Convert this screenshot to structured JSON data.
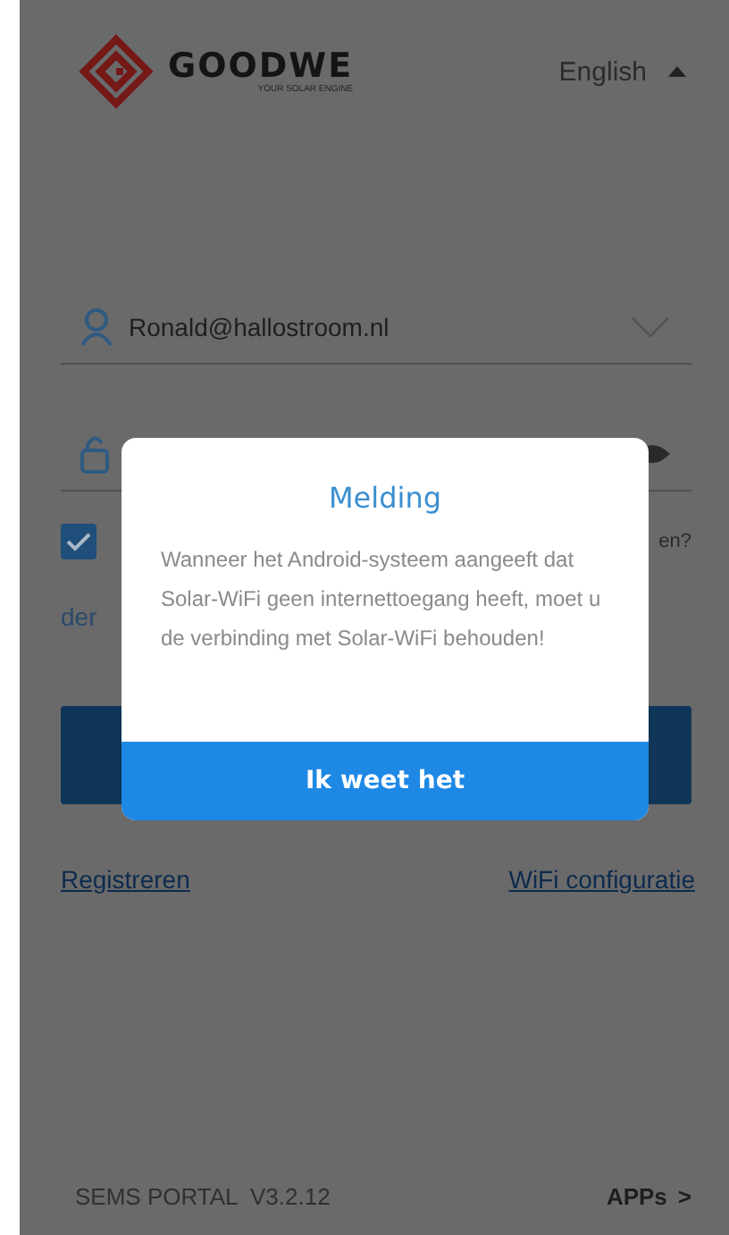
{
  "header": {
    "brand": "GOODWE",
    "tagline": "YOUR SOLAR ENGINE",
    "language": "English"
  },
  "login": {
    "username": "Ronald@hallostroom.nl",
    "remember_checked": true,
    "forgot_link_part": "en?",
    "agreement_link_part": "der"
  },
  "links": [
    "Registreren",
    "WiFi configuratie"
  ],
  "footer": {
    "version": "SEMS PORTAL  V3.2.12",
    "apps": "APPs",
    "apps_arrow": ">"
  },
  "dialog": {
    "title": "Melding",
    "message": "Wanneer het Android-systeem aangeeft dat Solar-WiFi geen internettoegang heeft, moet u de verbinding met Solar-WiFi behouden!",
    "button": "Ik weet het"
  }
}
